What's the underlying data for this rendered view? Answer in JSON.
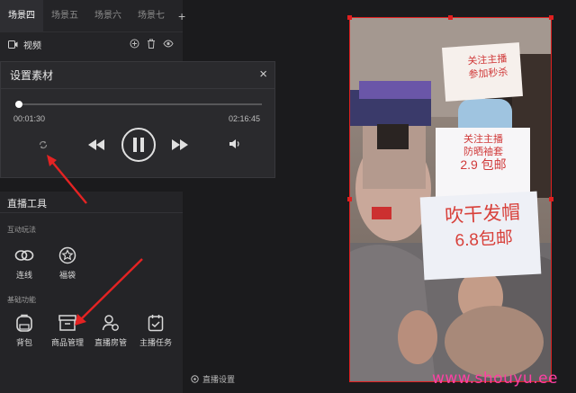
{
  "tabs": [
    "场景四",
    "场景五",
    "场景六",
    "场景七"
  ],
  "tab_add": "+",
  "scene_source": {
    "label": "视频"
  },
  "dialog": {
    "title": "设置素材",
    "close": "×",
    "current_time": "00:01:30",
    "total_time": "02:16:45",
    "progress": 0.011
  },
  "tools": {
    "title": "直播工具",
    "sections": [
      {
        "label": "互动玩法",
        "items": [
          {
            "label": "连线",
            "icon": "link-icon"
          },
          {
            "label": "福袋",
            "icon": "lucky-bag-icon"
          }
        ]
      },
      {
        "label": "基础功能",
        "items": [
          {
            "label": "背包",
            "icon": "backpack-icon"
          },
          {
            "label": "商品管理",
            "icon": "shop-icon"
          },
          {
            "label": "直播房管",
            "icon": "room-admin-icon"
          },
          {
            "label": "主播任务",
            "icon": "task-icon"
          }
        ]
      }
    ]
  },
  "preview": {
    "sign_top": [
      "关注主播",
      "参加秒杀"
    ],
    "sign_mid": [
      "关注主播",
      "防晒袖套",
      "2.9 包邮"
    ],
    "sign_bottom": [
      "吹干发帽",
      "6.8包邮"
    ]
  },
  "live_settings": "直播设置",
  "watermark": "www.shouyu.ee",
  "colors": {
    "accent_red": "#e02020",
    "watermark": "#ff3fa4",
    "background": "#1b1b1d"
  }
}
